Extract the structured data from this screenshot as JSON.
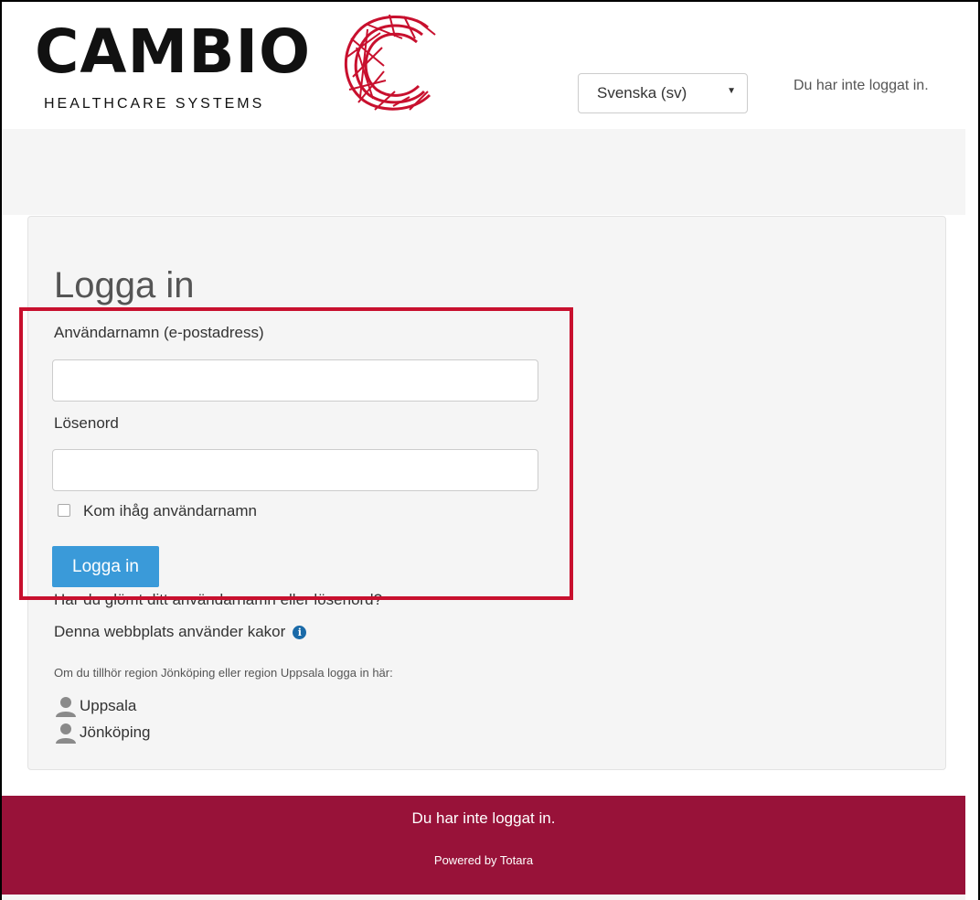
{
  "header": {
    "logo": {
      "brand": "CAMBIO",
      "tagline": "HEALTHCARE SYSTEMS"
    },
    "language": {
      "selected": "Svenska (sv)"
    },
    "login_status": "Du har inte loggat in."
  },
  "login": {
    "title": "Logga in",
    "username_label": "Användarnamn (e-postadress)",
    "username_value": "",
    "password_label": "Lösenord",
    "password_value": "",
    "remember_label": "Kom ihåg användarnamn",
    "remember_checked": false,
    "submit_label": "Logga in",
    "forgot_link": "Har du glömt ditt användarnamn eller lösenord?",
    "cookies_notice": "Denna webbplats använder kakor",
    "region_note": "Om du tillhör region Jönköping eller region Uppsala logga in här:",
    "identity_providers": [
      {
        "label": "Uppsala",
        "icon": "user-icon"
      },
      {
        "label": "Jönköping",
        "icon": "user-icon"
      }
    ]
  },
  "footer": {
    "login_status": "Du har inte loggat in.",
    "powered_by": "Powered by Totara"
  },
  "colors": {
    "brand_red": "#c8102e",
    "footer_bg": "#981239",
    "button_blue": "#3a9ad9"
  }
}
